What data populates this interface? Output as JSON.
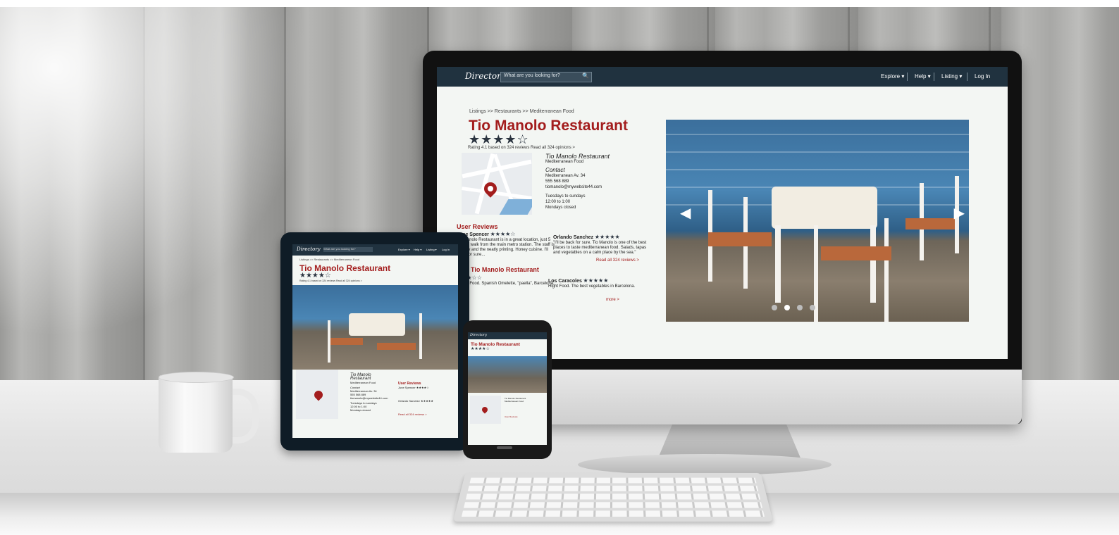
{
  "monitor": {
    "brand": "Directory",
    "search_placeholder": "What are you looking for?",
    "search_icon": "search-icon",
    "nav": [
      "Explore ▾",
      "Help ▾",
      "Listing ▾",
      "Log In"
    ],
    "breadcrumb": "Listings >> Restaurants >> Mediterranean Food",
    "title": "Tio Manolo Restaurant",
    "stars": "★★★★☆",
    "rating_text": "Rating 4.1 based on 324 reviews Read all 324 opinions >",
    "info": {
      "name": "Tio Manolo Restaurant",
      "cuisine": "Mediterranean Food",
      "contact_heading": "Contact",
      "address": "Mediterranean Av. 34",
      "phone": "555 568 889",
      "email": "tiomanolo@mywebsite44.com",
      "hours_line1": "Tuesdays to sundays",
      "hours_line2": "12:00 to 1:00",
      "hours_line3": "Mondays closed"
    },
    "reviews_title": "User Reviews",
    "reviews": [
      {
        "author": "June Spencer",
        "stars": "★★★★☆",
        "text": "Tio Manolo Restaurant is in a great location, just 5 minute walk from the main metro station. The staff is friendly and the neatly printing. Honey cuisine. I'll need for sure..."
      },
      {
        "author": "Orlando Sanchez",
        "stars": "★★★★★",
        "text": "\"I'll be back for sure. Tio Manolo is one of the best places to taste mediterranean food. Salads, tapas and vegetables on a calm place by the sea.\""
      }
    ],
    "read_all": "Read all 324 reviews >",
    "similar_title": "ar to Tio Manolo Restaurant",
    "similar": [
      {
        "author": "",
        "stars": "★★★☆☆",
        "text": "anean Food. Spanish Omelette, \"paella\", Barcelona."
      },
      {
        "author": "Los Caracoles",
        "stars": "★★★★★",
        "text": "Hight Food. The best vegetables in Barcelona."
      }
    ],
    "more": "more >",
    "carousel_left": "◀",
    "carousel_right": "▶"
  },
  "tablet": {
    "brand": "Directory",
    "search_placeholder": "What are you looking for?",
    "nav": [
      "Explore ▾",
      "Help ▾",
      "Listing ▾",
      "Log In"
    ],
    "breadcrumb": "Listings >> Restaurants >> Mediterranean Food",
    "title": "Tio Manolo Restaurant",
    "stars": "★★★★☆",
    "rating_text": "Rating 4.1 based on 324 reviews Read all 324 opinions >",
    "info": {
      "name": "Tio Manolo Restaurant",
      "cuisine": "Mediterranean Food",
      "contact_heading": "Contact",
      "address": "Mediterranean Av. 34",
      "phone": "555 568 889",
      "email": "tiomanolo@mywebsite44.com",
      "hours_line1": "Tuesdays to sundays",
      "hours_line2": "12:00 to 1:00",
      "hours_line3": "Mondays closed"
    },
    "reviews_title": "User Reviews",
    "review1": "June Spencer ★★★★☆",
    "review2": "Orlando Sanchez ★★★★★",
    "read_all": "Read all 324 reviews >"
  },
  "phone": {
    "brand": "Directory",
    "title": "Tio Manolo Restaurant",
    "stars": "★★★★☆",
    "info_name": "Tio Manolo Restaurant",
    "info_cuisine": "Mediterranean Food",
    "reviews_title": "User Reviews"
  }
}
